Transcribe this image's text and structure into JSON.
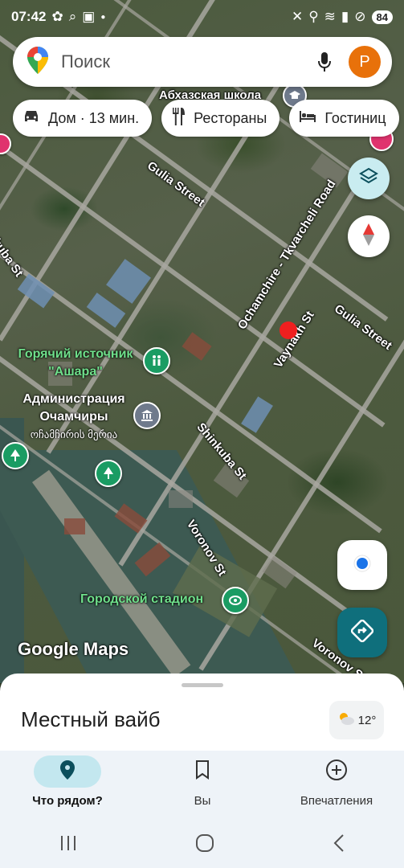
{
  "status_bar": {
    "time": "07:42",
    "battery": "84"
  },
  "search": {
    "placeholder": "Поиск",
    "avatar_letter": "P"
  },
  "chips": [
    {
      "icon": "car-icon",
      "label": "Дом · 13 мин."
    },
    {
      "icon": "restaurant-icon",
      "label": "Рестораны"
    },
    {
      "icon": "hotel-icon",
      "label": "Гостиниц"
    }
  ],
  "map": {
    "streets": [
      "Абхазская школа",
      "Gulia Street",
      "Ochamchire - Tkvarcheli Road",
      "Gulia Street",
      "Vaynakh St",
      "Shinkuba St",
      "Voronov St",
      "Voronov St",
      "kuba St"
    ],
    "pois": [
      {
        "name": "Горячий источник \"Ашара\""
      },
      {
        "name": "Администрация Очамчиры",
        "subname": "ოჩამჩირის მერია"
      },
      {
        "name": "Городской стадион"
      }
    ],
    "watermark": "Google Maps"
  },
  "sheet": {
    "title": "Местный вайб",
    "weather": "12°"
  },
  "bottom_nav": [
    {
      "label": "Что рядом?",
      "icon": "location-pin-icon",
      "active": true
    },
    {
      "label": "Вы",
      "icon": "bookmark-icon",
      "active": false
    },
    {
      "label": "Впечатления",
      "icon": "add-circle-icon",
      "active": false
    }
  ],
  "colors": {
    "accent_teal": "#0f6f7c",
    "avatar_orange": "#e8710a",
    "poi_green": "#1a9c63",
    "active_pill": "#c3e7ef",
    "red_dot": "#ef1f1f"
  }
}
